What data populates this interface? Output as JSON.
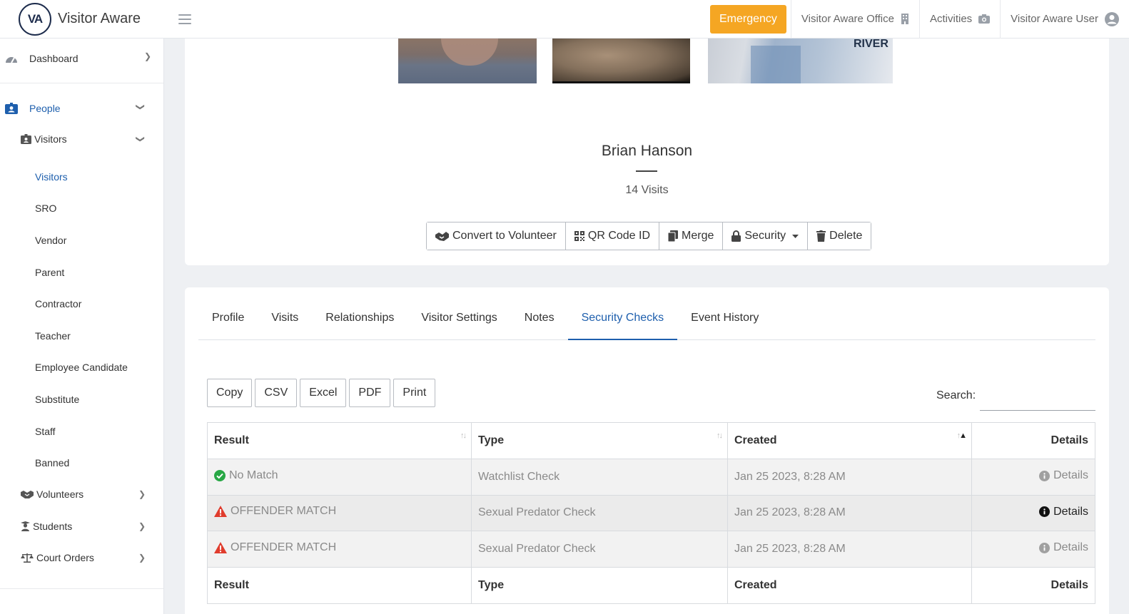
{
  "brand": {
    "name": "Visitor Aware",
    "logo_text": "VA"
  },
  "topbar": {
    "emergency_label": "Emergency",
    "office_label": "Visitor Aware Office",
    "activities_label": "Activities",
    "user_label": "Visitor Aware User"
  },
  "sidebar": {
    "dashboard": "Dashboard",
    "people": "People",
    "visitors_group": "Visitors",
    "sub_items": [
      "Visitors",
      "SRO",
      "Vendor",
      "Parent",
      "Contractor",
      "Teacher",
      "Employee Candidate",
      "Substitute",
      "Staff",
      "Banned"
    ],
    "volunteers": "Volunteers",
    "students": "Students",
    "court_orders": "Court Orders"
  },
  "profile": {
    "name": "Brian Hanson",
    "visits": "14 Visits",
    "photo3_text": "RIVER",
    "actions": {
      "convert": "Convert to Volunteer",
      "qr": "QR Code ID",
      "merge": "Merge",
      "security": "Security",
      "delete": "Delete"
    }
  },
  "tabs": [
    "Profile",
    "Visits",
    "Relationships",
    "Visitor Settings",
    "Notes",
    "Security Checks",
    "Event History"
  ],
  "active_tab": "Security Checks",
  "export_buttons": [
    "Copy",
    "CSV",
    "Excel",
    "PDF",
    "Print"
  ],
  "search": {
    "label": "Search:",
    "value": ""
  },
  "table": {
    "headers": [
      "Result",
      "Type",
      "Created",
      "Details"
    ],
    "rows": [
      {
        "result": "No Match",
        "status": "ok",
        "type": "Watchlist Check",
        "created": "Jan 25 2023, 8:28 AM",
        "details": "Details"
      },
      {
        "result": "OFFENDER MATCH",
        "status": "warn",
        "type": "Sexual Predator Check",
        "created": "Jan 25 2023, 8:28 AM",
        "details": "Details"
      },
      {
        "result": "OFFENDER MATCH",
        "status": "warn",
        "type": "Sexual Predator Check",
        "created": "Jan 25 2023, 8:28 AM",
        "details": "Details"
      }
    ],
    "footers": [
      "Result",
      "Type",
      "Created",
      "Details"
    ]
  },
  "colors": {
    "accent": "#1e5fad",
    "emergency": "#f5a623",
    "ok": "#28a745",
    "warn": "#e03c2d"
  }
}
